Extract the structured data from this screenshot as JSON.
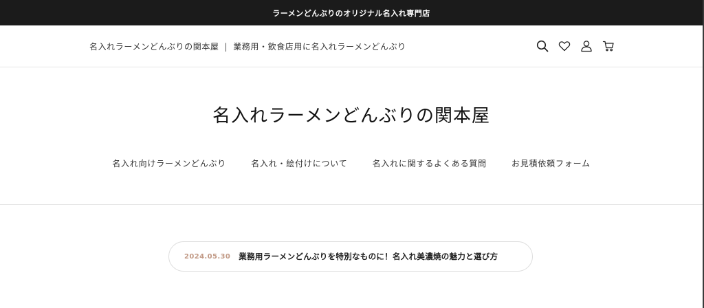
{
  "announcement": {
    "text": "ラーメンどんぶりのオリジナル名入れ専門店"
  },
  "header": {
    "site_name": "名入れラーメンどんぶりの関本屋",
    "separator": "|",
    "tagline": "業務用・飲食店用に名入れラーメンどんぶり",
    "icons": [
      "search-icon",
      "heart-icon",
      "user-icon",
      "cart-icon"
    ]
  },
  "logo": {
    "text": "名入れラーメンどんぶりの関本屋"
  },
  "nav": {
    "items": [
      {
        "label": "名入れ向けラーメンどんぶり"
      },
      {
        "label": "名入れ・絵付けについて"
      },
      {
        "label": "名入れに関するよくある質問"
      },
      {
        "label": "お見積依頼フォーム"
      }
    ]
  },
  "news": {
    "date": "2024.05.30",
    "title": "業務用ラーメンどんぶりを特別なものに！名入れ美濃焼の魅力と選び方"
  },
  "colors": {
    "announcement_bg": "#1b1b1b",
    "news_date": "#c29a86",
    "divider": "#e6e6e6"
  }
}
